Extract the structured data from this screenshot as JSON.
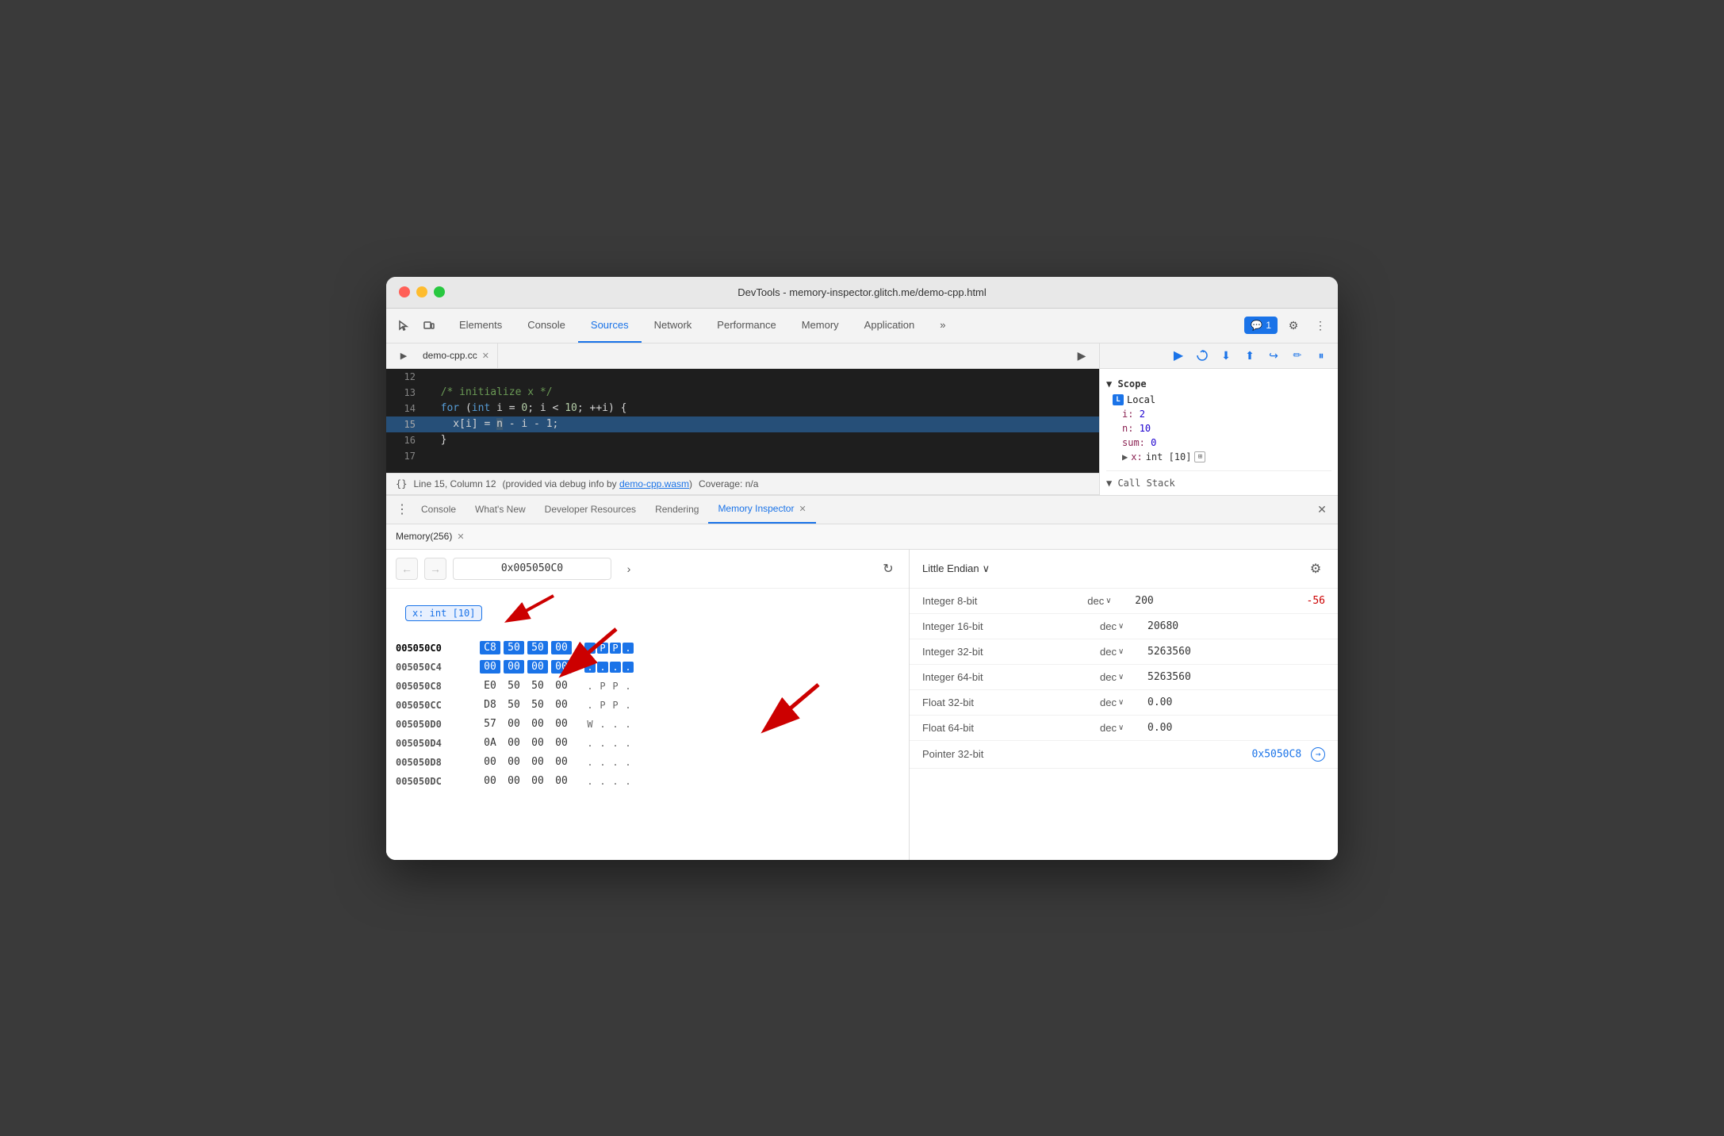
{
  "window": {
    "title": "DevTools - memory-inspector.glitch.me/demo-cpp.html"
  },
  "traffic_lights": {
    "red": "#ff5f57",
    "yellow": "#febc2e",
    "green": "#28c840"
  },
  "top_toolbar": {
    "tabs": [
      {
        "label": "Elements",
        "active": false
      },
      {
        "label": "Console",
        "active": false
      },
      {
        "label": "Sources",
        "active": true
      },
      {
        "label": "Network",
        "active": false
      },
      {
        "label": "Performance",
        "active": false
      },
      {
        "label": "Memory",
        "active": false
      },
      {
        "label": "Application",
        "active": false
      },
      {
        "label": "»",
        "active": false
      }
    ],
    "badge_label": "1",
    "settings_label": "⚙",
    "more_label": "⋮"
  },
  "source_panel": {
    "tab_name": "demo-cpp.cc",
    "code_lines": [
      {
        "num": "12",
        "content": ""
      },
      {
        "num": "13",
        "content": "  /* initialize x */"
      },
      {
        "num": "14",
        "content": "  for (int i = 0; i < 10; ++i) {"
      },
      {
        "num": "15",
        "content": "    x[i] = n - i - 1;",
        "highlighted": true
      },
      {
        "num": "16",
        "content": "  }"
      },
      {
        "num": "17",
        "content": ""
      }
    ],
    "status_bar": {
      "format": "{}",
      "position": "Line 15, Column 12",
      "info": "(provided via debug info by demo-cpp.wasm)",
      "coverage": "Coverage: n/a"
    }
  },
  "scope_panel": {
    "scope_title": "▼ Scope",
    "local_label": "▼ L Local",
    "items": [
      {
        "key": "i:",
        "value": "2"
      },
      {
        "key": "n:",
        "value": "10"
      },
      {
        "key": "sum:",
        "value": "0"
      },
      {
        "key": "▶ x:",
        "value": "int [10]",
        "has_icon": true
      }
    ]
  },
  "bottom_panel": {
    "tabs": [
      {
        "label": "Console",
        "active": false
      },
      {
        "label": "What's New",
        "active": false
      },
      {
        "label": "Developer Resources",
        "active": false
      },
      {
        "label": "Rendering",
        "active": false
      },
      {
        "label": "Memory Inspector",
        "active": true
      }
    ]
  },
  "memory_tab": {
    "tab_label": "Memory(256)",
    "address": "0x005050C0",
    "endian": "Little Endian",
    "tag_label": "x: int [10]",
    "hex_rows": [
      {
        "addr": "005050C0",
        "current": true,
        "bytes": [
          "C8",
          "50",
          "50",
          "00"
        ],
        "chars": [
          ".",
          "P",
          "P",
          "."
        ],
        "selected_row": true
      },
      {
        "addr": "005050C4",
        "bytes": [
          "00",
          "00",
          "00",
          "00"
        ],
        "chars": [
          ".",
          ".",
          ".",
          "."
        ],
        "selected_row": true
      },
      {
        "addr": "005050C8",
        "bytes": [
          "E0",
          "50",
          "50",
          "00"
        ],
        "chars": [
          ".",
          "P",
          "P",
          "."
        ]
      },
      {
        "addr": "005050CC",
        "bytes": [
          "D8",
          "50",
          "50",
          "00"
        ],
        "chars": [
          ".",
          "P",
          "P",
          "."
        ]
      },
      {
        "addr": "005050D0",
        "bytes": [
          "57",
          "00",
          "00",
          "00"
        ],
        "chars": [
          "W",
          ".",
          ".",
          "."
        ]
      },
      {
        "addr": "005050D4",
        "bytes": [
          "0A",
          "00",
          "00",
          "00"
        ],
        "chars": [
          ".",
          ".",
          ".",
          "."
        ]
      },
      {
        "addr": "005050D8",
        "bytes": [
          "00",
          "00",
          "00",
          "00"
        ],
        "chars": [
          ".",
          ".",
          ".",
          "."
        ]
      },
      {
        "addr": "005050DC",
        "bytes": [
          "00",
          "00",
          "00",
          "00"
        ],
        "chars": [
          ".",
          ".",
          ".",
          "."
        ]
      }
    ],
    "values": [
      {
        "type": "Integer 8-bit",
        "format": "dec",
        "value": "200",
        "neg": "-56"
      },
      {
        "type": "Integer 16-bit",
        "format": "dec",
        "value": "20680",
        "neg": ""
      },
      {
        "type": "Integer 32-bit",
        "format": "dec",
        "value": "5263560",
        "neg": ""
      },
      {
        "type": "Integer 64-bit",
        "format": "dec",
        "value": "5263560",
        "neg": ""
      },
      {
        "type": "Float 32-bit",
        "format": "dec",
        "value": "0.00",
        "neg": ""
      },
      {
        "type": "Float 64-bit",
        "format": "dec",
        "value": "0.00",
        "neg": ""
      },
      {
        "type": "Pointer 32-bit",
        "format": "",
        "value": "0x5050C8",
        "is_link": true
      }
    ]
  },
  "debug_toolbar_btns": [
    "▶",
    "↺",
    "⬇",
    "⬆",
    "↪",
    "✏",
    "⏸"
  ]
}
